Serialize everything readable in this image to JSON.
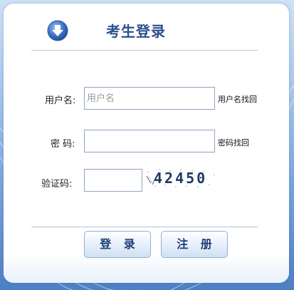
{
  "header": {
    "title": "考生登录",
    "icon": "download-arrow-icon"
  },
  "form": {
    "username": {
      "label": "用户名:",
      "placeholder": "用户名",
      "value": "",
      "recover_link": "用户名找回"
    },
    "password": {
      "label": "密  码:",
      "value": "",
      "recover_link": "密码找回"
    },
    "captcha": {
      "label": "验证码:",
      "value": "",
      "image_text": "42450"
    }
  },
  "buttons": {
    "login": "登 录",
    "register": "注 册"
  },
  "colors": {
    "title": "#2c4f8e",
    "button_text": "#1e3e78",
    "icon": "#3a6fc4"
  }
}
